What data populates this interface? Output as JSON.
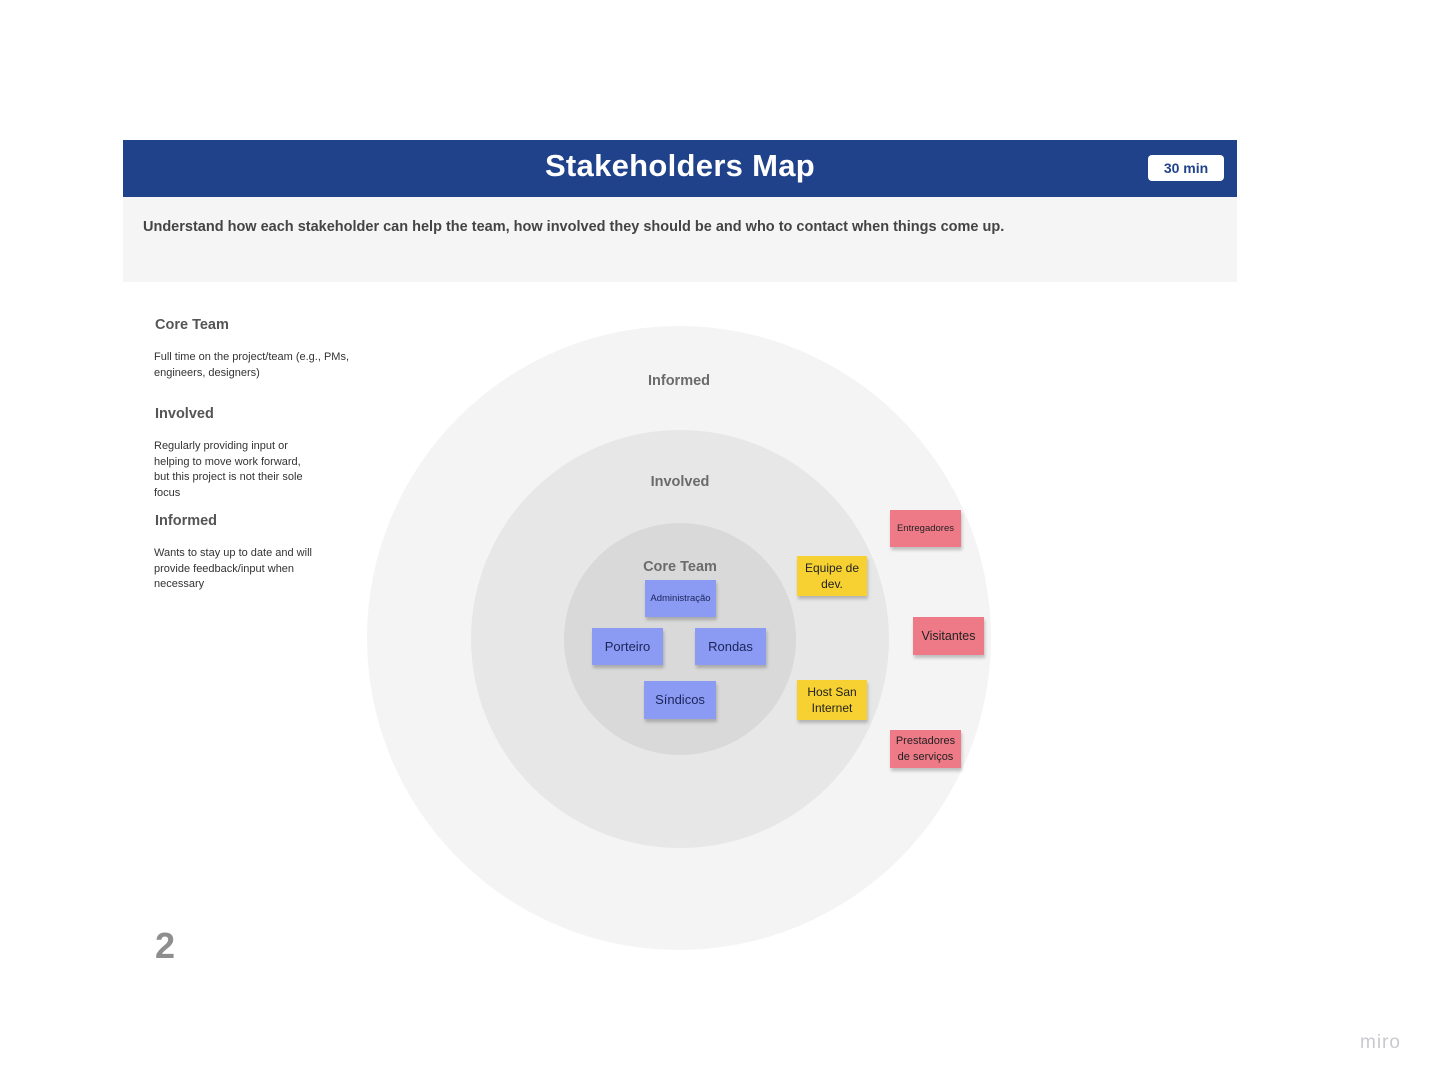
{
  "header": {
    "title": "Stakeholders Map",
    "badge": "30 min",
    "color": "#1f428a"
  },
  "description": "Understand how each stakeholder can help the team, how involved they should be and who to contact when things come up.",
  "legend": [
    {
      "heading": "Core Team",
      "lines": [
        "Full time on the project/team (e.g., PMs,",
        "engineers, designers)"
      ]
    },
    {
      "heading": "Involved",
      "lines": [
        "Regularly providing input or",
        "helping to move work forward,",
        "but this project is not their sole",
        "focus"
      ]
    },
    {
      "heading": "Informed",
      "lines": [
        "Wants to stay up to date and will",
        "provide feedback/input when",
        "necessary"
      ]
    }
  ],
  "rings": {
    "outer": "Informed",
    "middle": "Involved",
    "inner": "Core Team"
  },
  "stickies": {
    "core": [
      "Administração",
      "Porteiro",
      "Rondas",
      "Síndicos"
    ],
    "involved": [
      "Equipe de dev.",
      "Host San Internet"
    ],
    "informed": [
      "Entregadores",
      "Visitantes",
      "Prestadores de serviços"
    ]
  },
  "colors": {
    "core_sticky": "#8b9bf4",
    "involved_sticky": "#f6d131",
    "informed_sticky": "#ef7a87"
  },
  "page_number": "2",
  "brand": "miro"
}
